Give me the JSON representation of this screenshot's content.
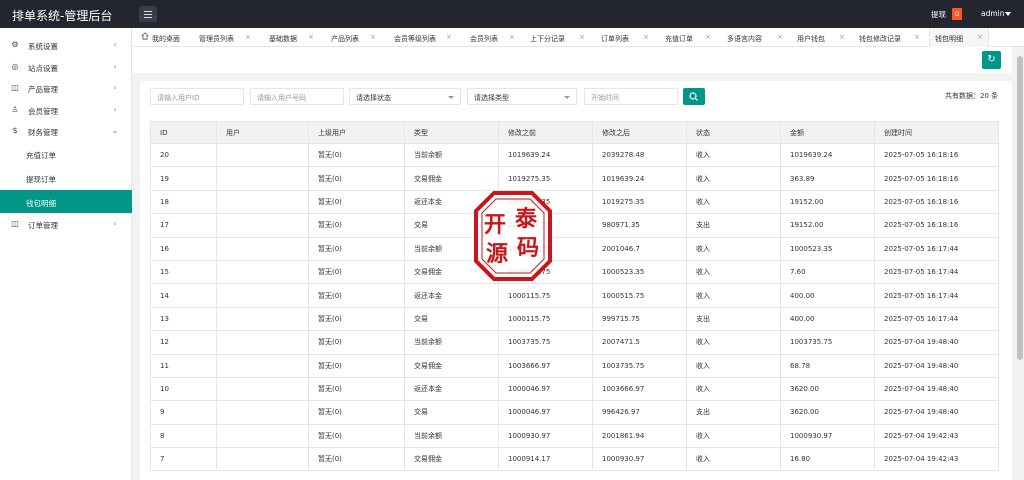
{
  "header": {
    "title": "排单系统-管理后台",
    "withdraw_label": "提现",
    "withdraw_count": "0",
    "user": "admin"
  },
  "sidebar": {
    "items": [
      {
        "label": "系统设置",
        "icon": "gear-icon"
      },
      {
        "label": "站点设置",
        "icon": "globe-icon"
      },
      {
        "label": "产品管理",
        "icon": "cube-icon"
      },
      {
        "label": "会员管理",
        "icon": "user-icon"
      },
      {
        "label": "财务管理",
        "icon": "dollar-icon"
      },
      {
        "label": "订单管理",
        "icon": "cube-icon"
      }
    ],
    "sub_items": [
      "充值订单",
      "提现订单",
      "钱包明细"
    ],
    "active_sub": "钱包明细"
  },
  "tabs": [
    "我的桌面",
    "管理员列表",
    "基础数据",
    "产品列表",
    "会员等级列表",
    "会员列表",
    "上下分记录",
    "订单列表",
    "充值订单",
    "多语言内容",
    "用户钱包",
    "钱包修改记录",
    "钱包明细"
  ],
  "active_tab": "钱包明细",
  "filters": {
    "user_id_placeholder": "请输入用户ID",
    "user_account_placeholder": "请输入用户号码",
    "status_select": "请选择状态",
    "type_select": "请选择类型",
    "start_time_placeholder": "开始时间"
  },
  "total_text": "共有数据：20 条",
  "table": {
    "columns": [
      "ID",
      "用户",
      "上级用户",
      "类型",
      "修改之前",
      "修改之后",
      "状态",
      "金额",
      "创建时间"
    ],
    "rows": [
      [
        "20",
        "",
        "暂无(0)",
        "当前余额",
        "1019639.24",
        "2039278.48",
        "收入",
        "1019639.24",
        "2025-07-05 16:18:16"
      ],
      [
        "19",
        "",
        "暂无(0)",
        "交易佣金",
        "1019275.35",
        "1019639.24",
        "收入",
        "363.89",
        "2025-07-05 16:18:16"
      ],
      [
        "18",
        "",
        "暂无(0)",
        "返还本金",
        "1000123.35",
        "1019275.35",
        "收入",
        "19152.00",
        "2025-07-05 16:18:16"
      ],
      [
        "17",
        "",
        "暂无(0)",
        "交易",
        "1000123.35",
        "980971.35",
        "支出",
        "19152.00",
        "2025-07-05 16:18:16"
      ],
      [
        "16",
        "",
        "暂无(0)",
        "当前余额",
        "1000523.35",
        "2001046.7",
        "收入",
        "1000523.35",
        "2025-07-05 16:17:44"
      ],
      [
        "15",
        "",
        "暂无(0)",
        "交易佣金",
        "1000515.75",
        "1000523.35",
        "收入",
        "7.60",
        "2025-07-05 16:17:44"
      ],
      [
        "14",
        "",
        "暂无(0)",
        "返还本金",
        "1000115.75",
        "1000515.75",
        "收入",
        "400.00",
        "2025-07-05 16:17:44"
      ],
      [
        "13",
        "",
        "暂无(0)",
        "交易",
        "1000115.75",
        "999715.75",
        "支出",
        "400.00",
        "2025-07-05 16:17:44"
      ],
      [
        "12",
        "",
        "暂无(0)",
        "当前余额",
        "1003735.75",
        "2007471.5",
        "收入",
        "1003735.75",
        "2025-07-04 19:48:40"
      ],
      [
        "11",
        "",
        "暂无(0)",
        "交易佣金",
        "1003666.97",
        "1003735.75",
        "收入",
        "68.78",
        "2025-07-04 19:48:40"
      ],
      [
        "10",
        "",
        "暂无(0)",
        "返还本金",
        "1000046.97",
        "1003666.97",
        "收入",
        "3620.00",
        "2025-07-04 19:48:40"
      ],
      [
        "9",
        "",
        "暂无(0)",
        "交易",
        "1000046.97",
        "996426.97",
        "支出",
        "3620.00",
        "2025-07-04 19:48:40"
      ],
      [
        "8",
        "",
        "暂无(0)",
        "当前余额",
        "1000930.97",
        "2001861.94",
        "收入",
        "1000930.97",
        "2025-07-04 19:42:43"
      ],
      [
        "7",
        "",
        "暂无(0)",
        "交易佣金",
        "1000914.17",
        "1000930.97",
        "收入",
        "16.80",
        "2025-07-04 19:42:43"
      ]
    ]
  },
  "watermark": [
    "开",
    "泰",
    "源",
    "码"
  ],
  "colors": {
    "accent": "#009688",
    "topbar": "#23262e",
    "badge": "#ff5722",
    "stamp": "#c8161d"
  }
}
